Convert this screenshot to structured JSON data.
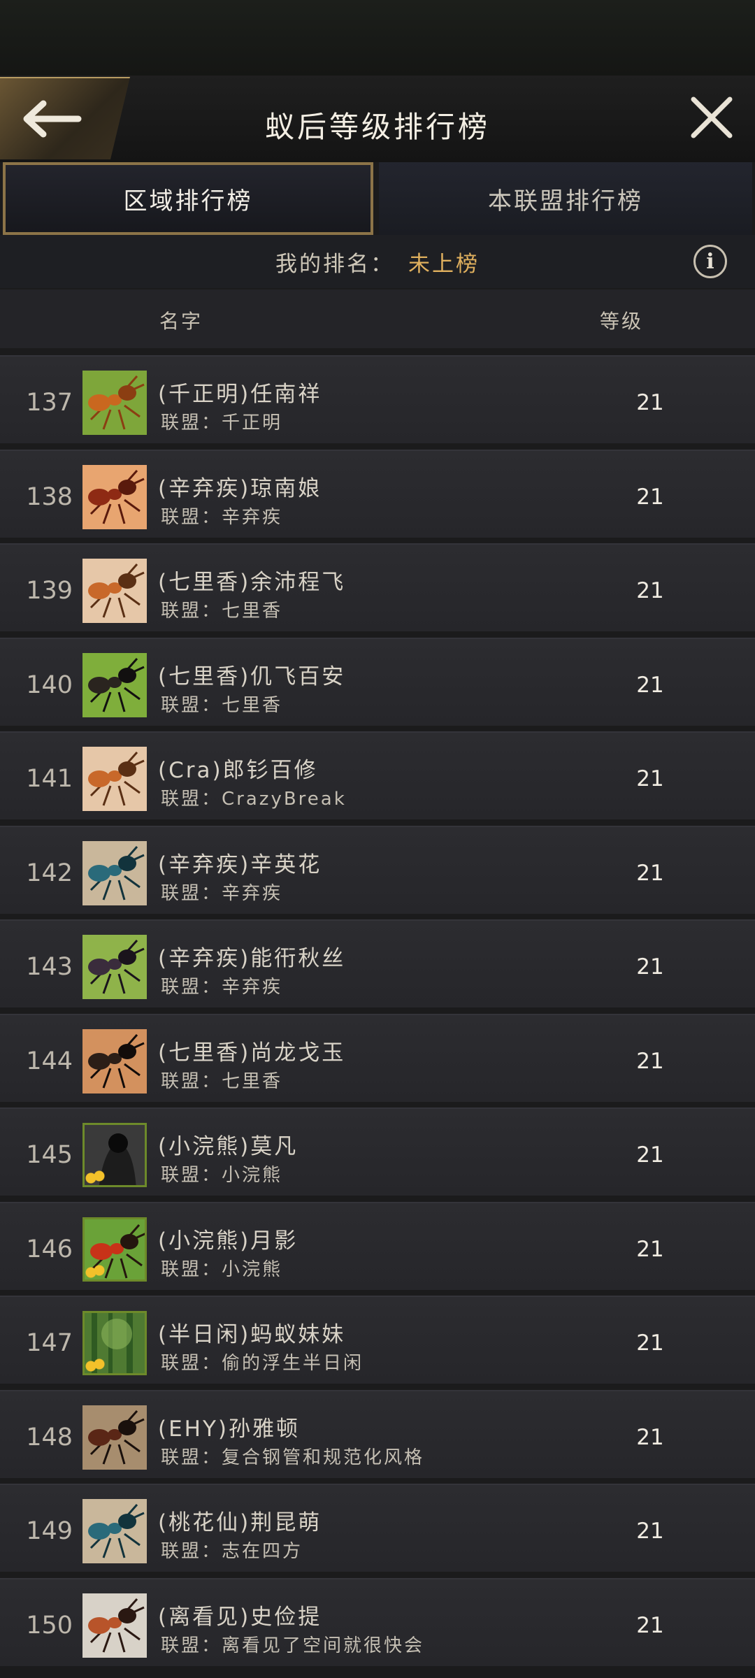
{
  "header": {
    "title": "蚁后等级排行榜",
    "back_icon": "arrow-left-icon",
    "close_icon": "close-icon"
  },
  "tabs": [
    {
      "label": "区域排行榜",
      "active": true
    },
    {
      "label": "本联盟排行榜",
      "active": false
    }
  ],
  "my_rank": {
    "label": "我的排名：",
    "value": "未上榜",
    "info_icon": "info-icon",
    "info_glyph": "i"
  },
  "columns": {
    "name": "名字",
    "level": "等级"
  },
  "alliance_prefix": "联盟：",
  "rows": [
    {
      "rank": "137",
      "name": "(千正明)任南祥",
      "alliance": "千正明",
      "level": "21",
      "avatar": "orange-ant",
      "bg": "#7ea63a",
      "c1": "#c9671f",
      "c2": "#8b3e12",
      "framed": false
    },
    {
      "rank": "138",
      "name": "(辛弃疾)琼南娘",
      "alliance": "辛弃疾",
      "level": "21",
      "avatar": "red-ant",
      "bg": "#e8a570",
      "c1": "#8e2a14",
      "c2": "#5a1a0c",
      "framed": false
    },
    {
      "rank": "139",
      "name": "(七里香)余沛程飞",
      "alliance": "七里香",
      "level": "21",
      "avatar": "orange-ant",
      "bg": "#e6c7a8",
      "c1": "#c8682a",
      "c2": "#5a2f14",
      "framed": false
    },
    {
      "rank": "140",
      "name": "(七里香)仉飞百安",
      "alliance": "七里香",
      "level": "21",
      "avatar": "black-ant",
      "bg": "#7fae3b",
      "c1": "#2a241f",
      "c2": "#121010",
      "framed": false
    },
    {
      "rank": "141",
      "name": "(Cra)郎钐百修",
      "alliance": "CrazyBreak",
      "level": "21",
      "avatar": "orange-ant",
      "bg": "#e6c7a8",
      "c1": "#c8682a",
      "c2": "#5a2f14",
      "framed": false
    },
    {
      "rank": "142",
      "name": "(辛弃疾)辛英花",
      "alliance": "辛弃疾",
      "level": "21",
      "avatar": "blue-ant",
      "bg": "#c9b79b",
      "c1": "#2a6a7a",
      "c2": "#12333c",
      "framed": false
    },
    {
      "rank": "143",
      "name": "(辛弃疾)能衎秋丝",
      "alliance": "辛弃疾",
      "level": "21",
      "avatar": "black-ant",
      "bg": "#8fb34a",
      "c1": "#3a2c3c",
      "c2": "#1a141c",
      "framed": false
    },
    {
      "rank": "144",
      "name": "(七里香)尚龙戈玉",
      "alliance": "七里香",
      "level": "21",
      "avatar": "black-ant",
      "bg": "#d3915e",
      "c1": "#2b1e17",
      "c2": "#120c0a",
      "framed": false
    },
    {
      "rank": "145",
      "name": "(小浣熊)莫凡",
      "alliance": "小浣熊",
      "level": "21",
      "avatar": "dark-figure",
      "bg": "#3a3a3a",
      "c1": "#1c1c1c",
      "c2": "#0a0a0a",
      "framed": true
    },
    {
      "rank": "146",
      "name": "(小浣熊)月影",
      "alliance": "小浣熊",
      "level": "21",
      "avatar": "red-ant",
      "bg": "#6aa238",
      "c1": "#c83218",
      "c2": "#24160e",
      "framed": true
    },
    {
      "rank": "147",
      "name": "(半日闲)蚂蚁妹妹",
      "alliance": "偷的浮生半日闲",
      "level": "21",
      "avatar": "forest",
      "bg": "#4f7a32",
      "c1": "#2f5a22",
      "c2": "#8cb45a",
      "framed": true
    },
    {
      "rank": "148",
      "name": "(EHY)孙雅顿",
      "alliance": "复合钢管和规范化风格",
      "level": "21",
      "avatar": "red-ant",
      "bg": "#a78d6e",
      "c1": "#5a2616",
      "c2": "#1a100c",
      "framed": false
    },
    {
      "rank": "149",
      "name": "(桃花仙)荆昆萌",
      "alliance": "志在四方",
      "level": "21",
      "avatar": "blue-ant",
      "bg": "#c9b79b",
      "c1": "#2a6a7a",
      "c2": "#12333c",
      "framed": false
    },
    {
      "rank": "150",
      "name": "(离看见)史俭提",
      "alliance": "离看见了空间就很快会",
      "level": "21",
      "avatar": "red-ant",
      "bg": "#d8d2c8",
      "c1": "#b8542a",
      "c2": "#2a1812",
      "framed": false
    }
  ]
}
